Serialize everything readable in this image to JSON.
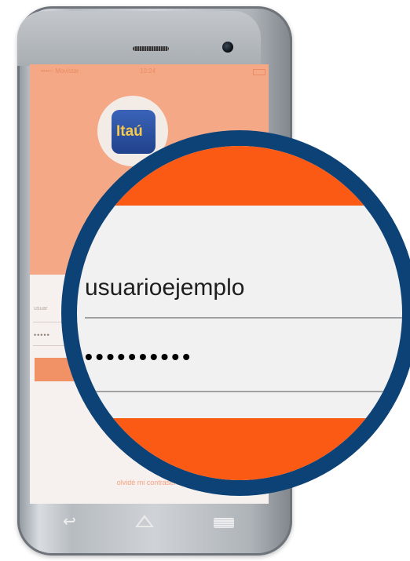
{
  "status_bar": {
    "carrier": "••••○ Movistar",
    "time": "10:24"
  },
  "logo": {
    "text": "Itaú"
  },
  "login": {
    "username_label_small": "usuar",
    "password_small": "•••••",
    "forgot_password": "olvidé mi contraseña"
  },
  "magnifier": {
    "username": "usuarioejemplo",
    "password": "••••••••••"
  },
  "colors": {
    "accent": "#FA5A14",
    "header_bg": "#F4A886",
    "lens_ring": "#0D4277"
  },
  "icons": [
    "back-icon",
    "home-icon",
    "recent-apps-icon"
  ]
}
